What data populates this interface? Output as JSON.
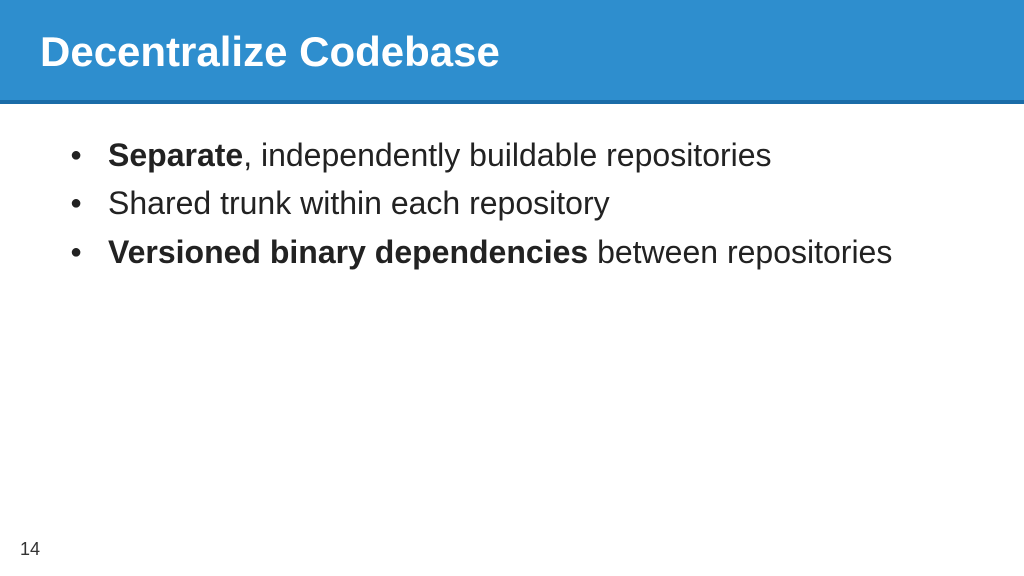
{
  "header": {
    "title": "Decentralize Codebase"
  },
  "bullets": {
    "item0_bold": "Separate",
    "item0_rest": ", independently buildable repositories",
    "item1": "Shared trunk within each repository",
    "item2_bold": "Versioned binary dependencies",
    "item2_rest": " between repositories"
  },
  "page_number": "14"
}
